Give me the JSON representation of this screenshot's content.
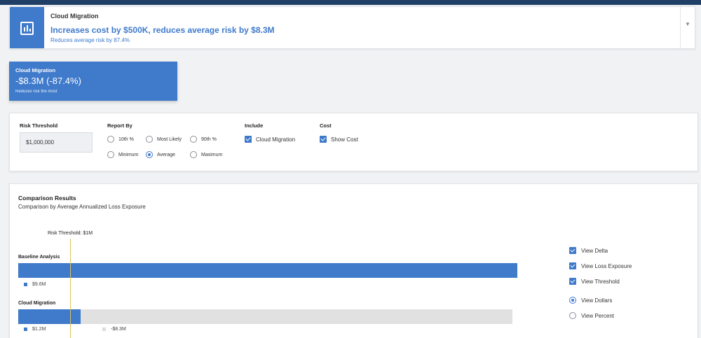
{
  "colors": {
    "accent": "#3f7acb",
    "remainder_bar": "#e1e1e1",
    "threshold_line": "#d8c25a"
  },
  "header": {
    "icon": "bar-chart-icon",
    "title": "Cloud Migration",
    "headline": "Increases cost by $500K, reduces average risk by $8.3M",
    "subline": "Reduces average risk by 87.4%",
    "expand_icon": "chevron-down-icon"
  },
  "summary_tile": {
    "title": "Cloud Migration",
    "value": "-$8.3M (-87.4%)",
    "caption": "Reduces risk the most"
  },
  "options": {
    "risk_threshold_label": "Risk Threshold",
    "risk_threshold_value": "$1,000,000",
    "report_by_label": "Report By",
    "report_by_options": [
      "10th %",
      "Most Likely",
      "90th %",
      "Minimum",
      "Average",
      "Maximum"
    ],
    "report_by_selected": "Average",
    "include_label": "Include",
    "include_item": "Cloud Migration",
    "include_checked": true,
    "cost_label": "Cost",
    "cost_item": "Show Cost",
    "cost_checked": true
  },
  "results": {
    "title": "Comparison Results",
    "subtitle": "Comparison by Average Annualized Loss Exposure",
    "threshold_label": "Risk Threshold: $1M"
  },
  "chart_data": {
    "type": "bar",
    "orientation": "horizontal",
    "threshold": 1.0,
    "unit": "$M",
    "scale_max": 9.6,
    "categories": [
      "Baseline Analysis",
      "Cloud Migration"
    ],
    "series": [
      {
        "values": [
          9.6,
          1.2
        ],
        "labels": [
          "$9.6M",
          "$1.2M"
        ]
      },
      {
        "values": [
          null,
          -8.3
        ],
        "labels": [
          "",
          "-$8.3M"
        ]
      }
    ]
  },
  "view_options": [
    {
      "label": "View Delta",
      "kind": "checkbox",
      "checked": true
    },
    {
      "label": "View Loss Exposure",
      "kind": "checkbox",
      "checked": true
    },
    {
      "label": "View Threshold",
      "kind": "checkbox",
      "checked": true
    },
    {
      "label": "View Dollars",
      "kind": "radio",
      "checked": true
    },
    {
      "label": "View Percent",
      "kind": "radio",
      "checked": false
    }
  ]
}
